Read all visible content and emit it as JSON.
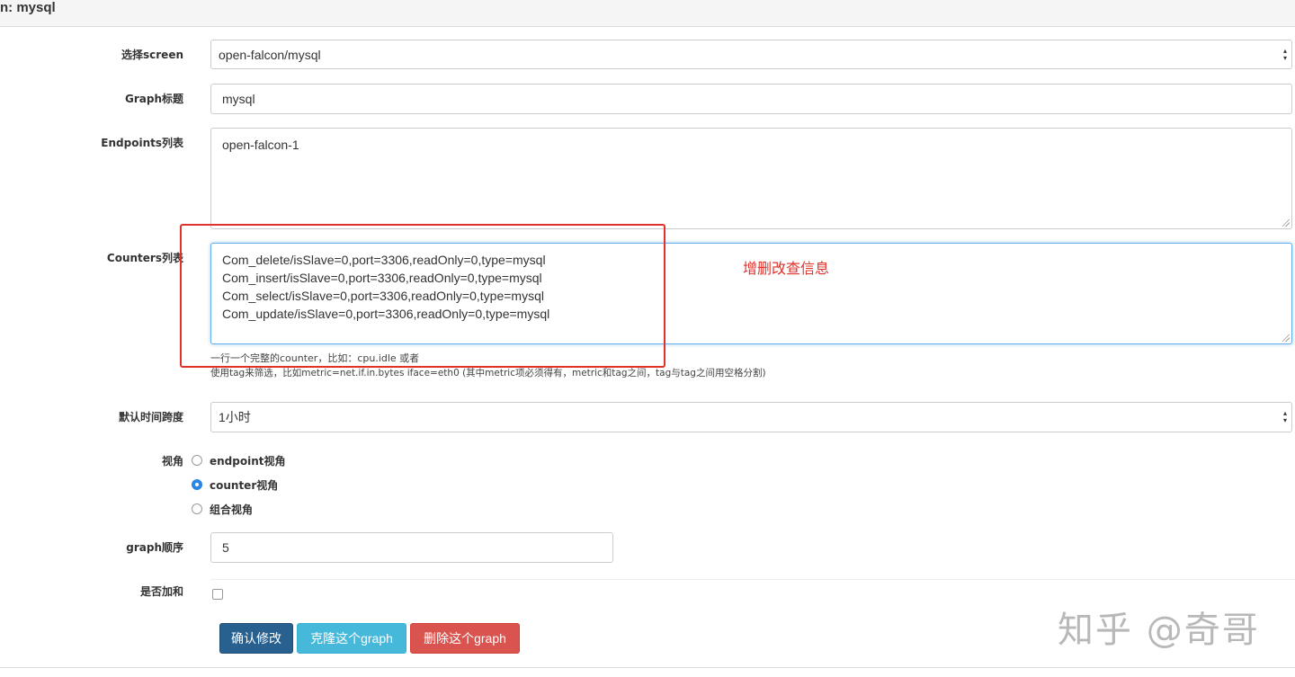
{
  "header": {
    "title": "n: mysql"
  },
  "form": {
    "screen": {
      "label": "选择screen",
      "value": "open-falcon/mysql"
    },
    "graph_title": {
      "label": "Graph标题",
      "value": "mysql"
    },
    "endpoints": {
      "label": "Endpoints列表",
      "lines": [
        "open-falcon-1"
      ]
    },
    "counters": {
      "label": "Counters列表",
      "lines": [
        "Com_delete/isSlave=0,port=3306,readOnly=0,type=mysql",
        "Com_insert/isSlave=0,port=3306,readOnly=0,type=mysql",
        "Com_select/isSlave=0,port=3306,readOnly=0,type=mysql",
        "Com_update/isSlave=0,port=3306,readOnly=0,type=mysql"
      ],
      "help1": "一行一个完整的counter，比如：cpu.idle 或者",
      "help2": "使用tag来筛选，比如metric=net.if.in.bytes iface=eth0 (其中metric项必须得有，metric和tag之间，tag与tag之间用空格分割)"
    },
    "timespan": {
      "label": "默认时间跨度",
      "value": "1小时"
    },
    "view": {
      "label": "视角",
      "options": [
        {
          "label": "endpoint视角",
          "checked": false
        },
        {
          "label": "counter视角",
          "checked": true
        },
        {
          "label": "组合视角",
          "checked": false
        }
      ]
    },
    "graph_order": {
      "label": "graph顺序",
      "value": "5"
    },
    "sum": {
      "label": "是否加和",
      "checked": false
    }
  },
  "buttons": {
    "confirm": "确认修改",
    "clone": "克隆这个graph",
    "delete": "删除这个graph"
  },
  "annotation": {
    "text": "增删改查信息"
  },
  "watermark": "知乎 @奇哥",
  "colors": {
    "primary": "#286090",
    "info": "#46b8da",
    "danger": "#d9534f",
    "annotation": "#e0312b"
  }
}
